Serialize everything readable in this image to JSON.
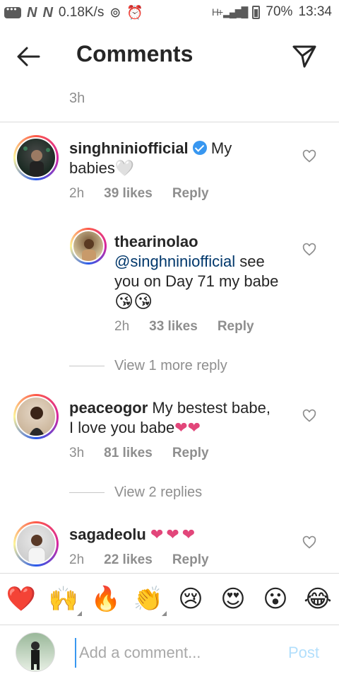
{
  "status_bar": {
    "network_speed": "0.18K/s",
    "network_type": "H+",
    "battery": "70%",
    "time": "13:34",
    "icons": [
      "message-icon",
      "n-notification-icon",
      "n-notification-icon",
      "hotspot-icon",
      "alarm-icon",
      "signal-icon",
      "battery-icon"
    ]
  },
  "header": {
    "title": "Comments",
    "icons": [
      "back-arrow-icon",
      "send-icon"
    ]
  },
  "top_timestamp": "3h",
  "comments": [
    {
      "username": "singhniniofficial",
      "verified": true,
      "text_line1": "My",
      "text_line2": "babies⁠🤍",
      "time": "2h",
      "likes": "39 likes",
      "reply": "Reply"
    },
    {
      "username": "thearinolao",
      "mention": "@singhniniofficial",
      "text_after_mention": "see",
      "text_line2": "you on Day 71 my babe",
      "emojis": "😘😘",
      "time": "2h",
      "likes": "33 likes",
      "reply": "Reply"
    },
    {
      "username": "peaceogor",
      "text_line1": "My bestest babe,",
      "text_line2": "I love you babe",
      "emojis": "❤❤",
      "time": "3h",
      "likes": "81 likes",
      "reply": "Reply"
    },
    {
      "username": "sagadeolu",
      "emojis": "❤❤❤",
      "time": "2h",
      "likes": "22 likes",
      "reply": "Reply"
    }
  ],
  "view_more_1": "View 1 more reply",
  "view_more_2": "View 2 replies",
  "emoji_bar": [
    "❤️",
    "🙌",
    "🔥",
    "👏",
    "😢",
    "😍",
    "😮",
    "😂"
  ],
  "input": {
    "placeholder": "Add a comment...",
    "post_label": "Post"
  },
  "colors": {
    "link": "#00376b",
    "secondary_text": "#8e8e8e",
    "heart": "#e2467a",
    "post_disabled": "#b2dffc",
    "verified": "#3897f0"
  }
}
